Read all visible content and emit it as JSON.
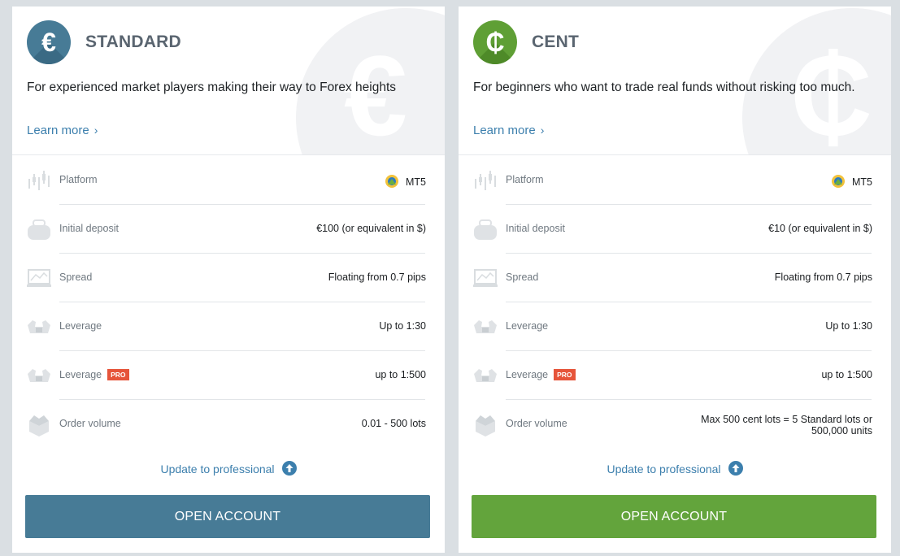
{
  "colors": {
    "standard_accent": "#477b96",
    "cent_accent": "#63a43c",
    "link": "#3c7fad",
    "pro_badge": "#e6543a",
    "page_background": "#dadfe3"
  },
  "cards": [
    {
      "id": "standard",
      "symbol": "€",
      "icon": "euro-icon",
      "title": "STANDARD",
      "tagline": "For experienced market players making their way to Forex heights",
      "learn_more": "Learn more",
      "rows": [
        {
          "icon": "platform-chart-icon",
          "label": "Platform",
          "value": "MT5",
          "value_icon": "mt5-icon"
        },
        {
          "icon": "wallet-icon",
          "label": "Initial deposit",
          "value": "€100 (or equivalent in $)"
        },
        {
          "icon": "spread-laptop-icon",
          "label": "Spread",
          "value": "Floating from 0.7 pips"
        },
        {
          "icon": "leverage-muscle-icon",
          "label": "Leverage",
          "value": "Up to 1:30"
        },
        {
          "icon": "leverage-muscle-icon",
          "label": "Leverage",
          "badge": "PRO",
          "value": "up to 1:500"
        },
        {
          "icon": "box-volume-icon",
          "label": "Order volume",
          "value": "0.01 - 500 lots"
        }
      ],
      "update_label": "Update to professional",
      "open_account": "OPEN ACCOUNT"
    },
    {
      "id": "cent",
      "symbol": "₵",
      "icon": "cent-icon",
      "title": "CENT",
      "tagline": "For beginners who want to trade real funds without risking too much.",
      "learn_more": "Learn more",
      "rows": [
        {
          "icon": "platform-chart-icon",
          "label": "Platform",
          "value": "MT5",
          "value_icon": "mt5-icon"
        },
        {
          "icon": "wallet-icon",
          "label": "Initial deposit",
          "value": "€10 (or equivalent in $)"
        },
        {
          "icon": "spread-laptop-icon",
          "label": "Spread",
          "value": "Floating from 0.7 pips"
        },
        {
          "icon": "leverage-muscle-icon",
          "label": "Leverage",
          "value": "Up to 1:30"
        },
        {
          "icon": "leverage-muscle-icon",
          "label": "Leverage",
          "badge": "PRO",
          "value": "up to 1:500"
        },
        {
          "icon": "box-volume-icon",
          "label": "Order volume",
          "value": "Max 500 cent lots = 5 Standard lots or 500,000 units"
        }
      ],
      "update_label": "Update to professional",
      "open_account": "OPEN ACCOUNT"
    }
  ]
}
